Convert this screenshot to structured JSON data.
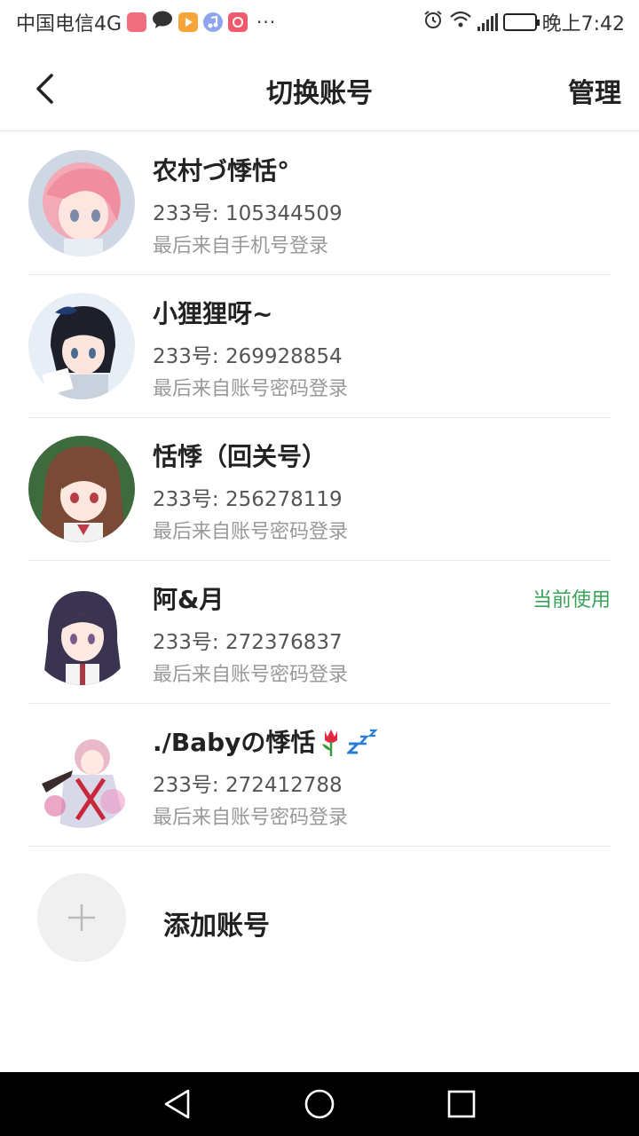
{
  "status_bar": {
    "carrier": "中国电信4G",
    "time": "晚上7:42",
    "more": "···",
    "icons": [
      "heart-app-icon",
      "chat-icon",
      "video-icon",
      "music-icon",
      "photo-icon",
      "alarm-icon",
      "wifi-icon",
      "signal-icon",
      "battery-icon"
    ]
  },
  "header": {
    "title": "切换账号",
    "manage_label": "管理"
  },
  "accounts": [
    {
      "name": "农村づ悸恬°",
      "id": "233号: 105344509",
      "login": "最后来自手机号登录",
      "current": ""
    },
    {
      "name": "小狸狸呀~",
      "id": "233号: 269928854",
      "login": "最后来自账号密码登录",
      "current": ""
    },
    {
      "name": "恬悸（回关号）",
      "id": "233号: 256278119",
      "login": "最后来自账号密码登录",
      "current": ""
    },
    {
      "name": "阿&月",
      "id": "233号: 272376837",
      "login": "最后来自账号密码登录",
      "current": "当前使用"
    },
    {
      "name": "./Babyの悸恬",
      "id": "233号: 272412788",
      "login": "最后来自账号密码登录",
      "current": ""
    }
  ],
  "add_account": {
    "label": "添加账号"
  },
  "colors": {
    "accent_green": "#3aa35a",
    "divider": "#e8e8e8",
    "nav_bg": "#000000"
  }
}
